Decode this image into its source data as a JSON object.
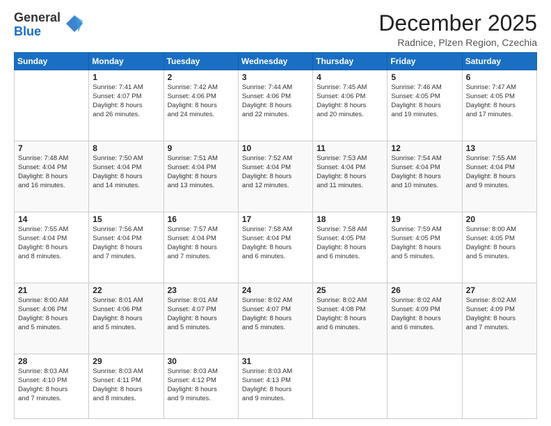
{
  "logo": {
    "general": "General",
    "blue": "Blue"
  },
  "header": {
    "month": "December 2025",
    "location": "Radnice, Plzen Region, Czechia"
  },
  "weekdays": [
    "Sunday",
    "Monday",
    "Tuesday",
    "Wednesday",
    "Thursday",
    "Friday",
    "Saturday"
  ],
  "weeks": [
    [
      {
        "day": "",
        "info": ""
      },
      {
        "day": "1",
        "info": "Sunrise: 7:41 AM\nSunset: 4:07 PM\nDaylight: 8 hours\nand 26 minutes."
      },
      {
        "day": "2",
        "info": "Sunrise: 7:42 AM\nSunset: 4:06 PM\nDaylight: 8 hours\nand 24 minutes."
      },
      {
        "day": "3",
        "info": "Sunrise: 7:44 AM\nSunset: 4:06 PM\nDaylight: 8 hours\nand 22 minutes."
      },
      {
        "day": "4",
        "info": "Sunrise: 7:45 AM\nSunset: 4:06 PM\nDaylight: 8 hours\nand 20 minutes."
      },
      {
        "day": "5",
        "info": "Sunrise: 7:46 AM\nSunset: 4:05 PM\nDaylight: 8 hours\nand 19 minutes."
      },
      {
        "day": "6",
        "info": "Sunrise: 7:47 AM\nSunset: 4:05 PM\nDaylight: 8 hours\nand 17 minutes."
      }
    ],
    [
      {
        "day": "7",
        "info": "Sunrise: 7:48 AM\nSunset: 4:04 PM\nDaylight: 8 hours\nand 16 minutes."
      },
      {
        "day": "8",
        "info": "Sunrise: 7:50 AM\nSunset: 4:04 PM\nDaylight: 8 hours\nand 14 minutes."
      },
      {
        "day": "9",
        "info": "Sunrise: 7:51 AM\nSunset: 4:04 PM\nDaylight: 8 hours\nand 13 minutes."
      },
      {
        "day": "10",
        "info": "Sunrise: 7:52 AM\nSunset: 4:04 PM\nDaylight: 8 hours\nand 12 minutes."
      },
      {
        "day": "11",
        "info": "Sunrise: 7:53 AM\nSunset: 4:04 PM\nDaylight: 8 hours\nand 11 minutes."
      },
      {
        "day": "12",
        "info": "Sunrise: 7:54 AM\nSunset: 4:04 PM\nDaylight: 8 hours\nand 10 minutes."
      },
      {
        "day": "13",
        "info": "Sunrise: 7:55 AM\nSunset: 4:04 PM\nDaylight: 8 hours\nand 9 minutes."
      }
    ],
    [
      {
        "day": "14",
        "info": "Sunrise: 7:55 AM\nSunset: 4:04 PM\nDaylight: 8 hours\nand 8 minutes."
      },
      {
        "day": "15",
        "info": "Sunrise: 7:56 AM\nSunset: 4:04 PM\nDaylight: 8 hours\nand 7 minutes."
      },
      {
        "day": "16",
        "info": "Sunrise: 7:57 AM\nSunset: 4:04 PM\nDaylight: 8 hours\nand 7 minutes."
      },
      {
        "day": "17",
        "info": "Sunrise: 7:58 AM\nSunset: 4:04 PM\nDaylight: 8 hours\nand 6 minutes."
      },
      {
        "day": "18",
        "info": "Sunrise: 7:58 AM\nSunset: 4:05 PM\nDaylight: 8 hours\nand 6 minutes."
      },
      {
        "day": "19",
        "info": "Sunrise: 7:59 AM\nSunset: 4:05 PM\nDaylight: 8 hours\nand 5 minutes."
      },
      {
        "day": "20",
        "info": "Sunrise: 8:00 AM\nSunset: 4:05 PM\nDaylight: 8 hours\nand 5 minutes."
      }
    ],
    [
      {
        "day": "21",
        "info": "Sunrise: 8:00 AM\nSunset: 4:06 PM\nDaylight: 8 hours\nand 5 minutes."
      },
      {
        "day": "22",
        "info": "Sunrise: 8:01 AM\nSunset: 4:06 PM\nDaylight: 8 hours\nand 5 minutes."
      },
      {
        "day": "23",
        "info": "Sunrise: 8:01 AM\nSunset: 4:07 PM\nDaylight: 8 hours\nand 5 minutes."
      },
      {
        "day": "24",
        "info": "Sunrise: 8:02 AM\nSunset: 4:07 PM\nDaylight: 8 hours\nand 5 minutes."
      },
      {
        "day": "25",
        "info": "Sunrise: 8:02 AM\nSunset: 4:08 PM\nDaylight: 8 hours\nand 6 minutes."
      },
      {
        "day": "26",
        "info": "Sunrise: 8:02 AM\nSunset: 4:09 PM\nDaylight: 8 hours\nand 6 minutes."
      },
      {
        "day": "27",
        "info": "Sunrise: 8:02 AM\nSunset: 4:09 PM\nDaylight: 8 hours\nand 7 minutes."
      }
    ],
    [
      {
        "day": "28",
        "info": "Sunrise: 8:03 AM\nSunset: 4:10 PM\nDaylight: 8 hours\nand 7 minutes."
      },
      {
        "day": "29",
        "info": "Sunrise: 8:03 AM\nSunset: 4:11 PM\nDaylight: 8 hours\nand 8 minutes."
      },
      {
        "day": "30",
        "info": "Sunrise: 8:03 AM\nSunset: 4:12 PM\nDaylight: 8 hours\nand 9 minutes."
      },
      {
        "day": "31",
        "info": "Sunrise: 8:03 AM\nSunset: 4:13 PM\nDaylight: 8 hours\nand 9 minutes."
      },
      {
        "day": "",
        "info": ""
      },
      {
        "day": "",
        "info": ""
      },
      {
        "day": "",
        "info": ""
      }
    ]
  ]
}
